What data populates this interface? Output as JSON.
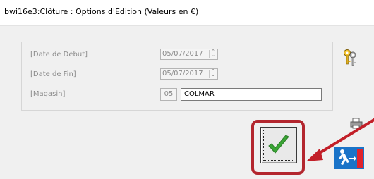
{
  "window": {
    "title": "bwi16e3:Clôture : Options d'Edition (Valeurs en €)"
  },
  "form": {
    "date_debut_label": "[Date de Début]",
    "date_debut_value": "05/07/2017",
    "date_fin_label": "[Date de Fin]",
    "date_fin_value": "05/07/2017",
    "magasin_label": "[Magasin]",
    "magasin_code": "05",
    "magasin_name": "COLMAR"
  },
  "icons": {
    "keys": "keys-icon",
    "printer": "printer-icon",
    "validate": "checkmark-icon",
    "exit": "exit-icon",
    "annotation": "red-arrow-annotation"
  },
  "colors": {
    "highlight_frame": "#b3262e",
    "check_green": "#3aa535",
    "exit_blue": "#1a73c8",
    "exit_red": "#e0232b"
  }
}
